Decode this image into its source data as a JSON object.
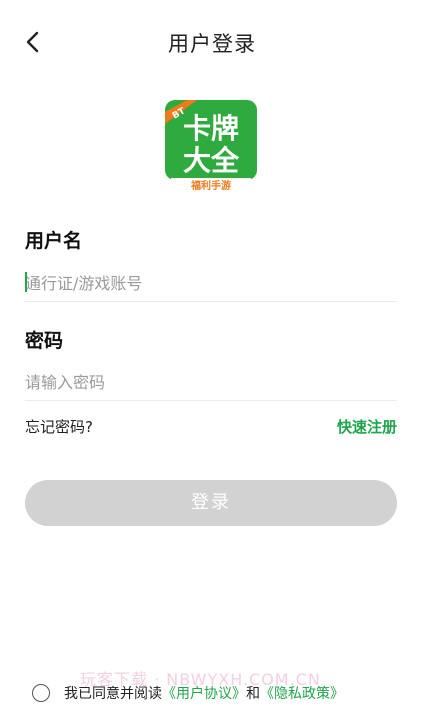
{
  "header": {
    "title": "用户登录",
    "back_icon": "chevron-left-icon"
  },
  "logo": {
    "badge": "BT",
    "line1": "卡牌",
    "line2": "大全",
    "caption": "福利手游",
    "color_green": "#2eaa3e",
    "color_badge": "#f07a1a"
  },
  "form": {
    "username_label": "用户名",
    "username_placeholder": "通行证/游戏账号",
    "password_label": "密码",
    "password_placeholder": "请输入密码",
    "forgot_label": "忘记密码?",
    "register_label": "快速注册",
    "login_label": "登录"
  },
  "watermark": "玩客下载 · NBWYXH.COM.CN",
  "agreement": {
    "prefix": "我已同意并阅读",
    "user_agreement": "《用户协议》",
    "and": "和",
    "privacy_policy": "《隐私政策》"
  },
  "colors": {
    "accent": "#1fa64a",
    "button_disabled": "#d2d2d2"
  }
}
